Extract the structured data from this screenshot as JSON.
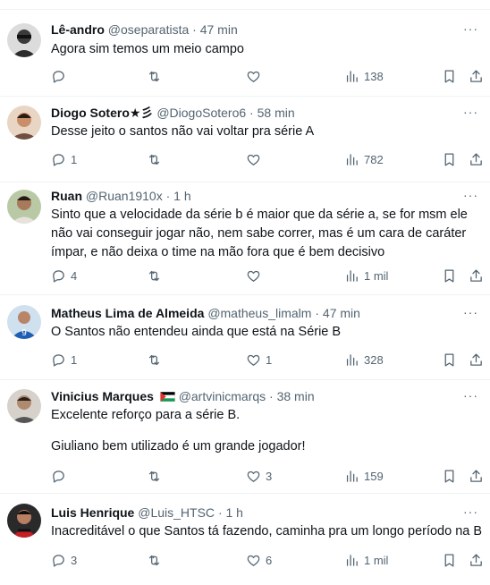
{
  "tweets": [
    {
      "name": "Lê-andro",
      "badge": "",
      "handle": "@oseparatista",
      "time": "47 min",
      "paragraphs": [
        "Agora sim temos um meio campo"
      ],
      "replies": "",
      "retweets": "",
      "likes": "",
      "views": "138"
    },
    {
      "name": "Diogo Sotero★彡",
      "badge": "",
      "handle": "@DiogoSotero6",
      "time": "58 min",
      "paragraphs": [
        "Desse jeito o santos não vai voltar pra série A"
      ],
      "replies": "1",
      "retweets": "",
      "likes": "",
      "views": "782"
    },
    {
      "name": "Ruan",
      "badge": "",
      "handle": "@Ruan1910x",
      "time": "1 h",
      "paragraphs": [
        "Sinto que a velocidade da série b é maior que da série a, se for msm ele não vai conseguir jogar não, nem sabe correr, mas é um cara de caráter ímpar, e não deixa o time na mão fora que é bem decisivo"
      ],
      "replies": "4",
      "retweets": "",
      "likes": "",
      "views": "1 mil"
    },
    {
      "name": "Matheus Lima de Almeida",
      "badge": "",
      "handle": "@matheus_limalm",
      "time": "47 min",
      "paragraphs": [
        "O Santos não entendeu ainda que está na Série B"
      ],
      "replies": "1",
      "retweets": "",
      "likes": "1",
      "views": "328"
    },
    {
      "name": "Vinicius Marques",
      "badge": "flag",
      "handle": "@artvinicmarqs",
      "time": "38 min",
      "paragraphs": [
        "Excelente reforço para a série B.",
        "Giuliano bem utilizado é um grande jogador!"
      ],
      "replies": "",
      "retweets": "",
      "likes": "3",
      "views": "159"
    },
    {
      "name": "Luis Henrique",
      "badge": "",
      "handle": "@Luis_HTSC",
      "time": "1 h",
      "paragraphs": [
        "Inacreditável o que Santos tá fazendo, caminha pra um longo período na B"
      ],
      "replies": "3",
      "retweets": "",
      "likes": "6",
      "views": "1 mil"
    }
  ],
  "sep": "·",
  "colors": {
    "text": "#0f1419",
    "secondary": "#536471",
    "divider": "#eff3f4"
  },
  "icons": [
    "reply-icon",
    "retweet-icon",
    "like-icon",
    "views-icon",
    "bookmark-icon",
    "share-icon",
    "more-icon"
  ]
}
